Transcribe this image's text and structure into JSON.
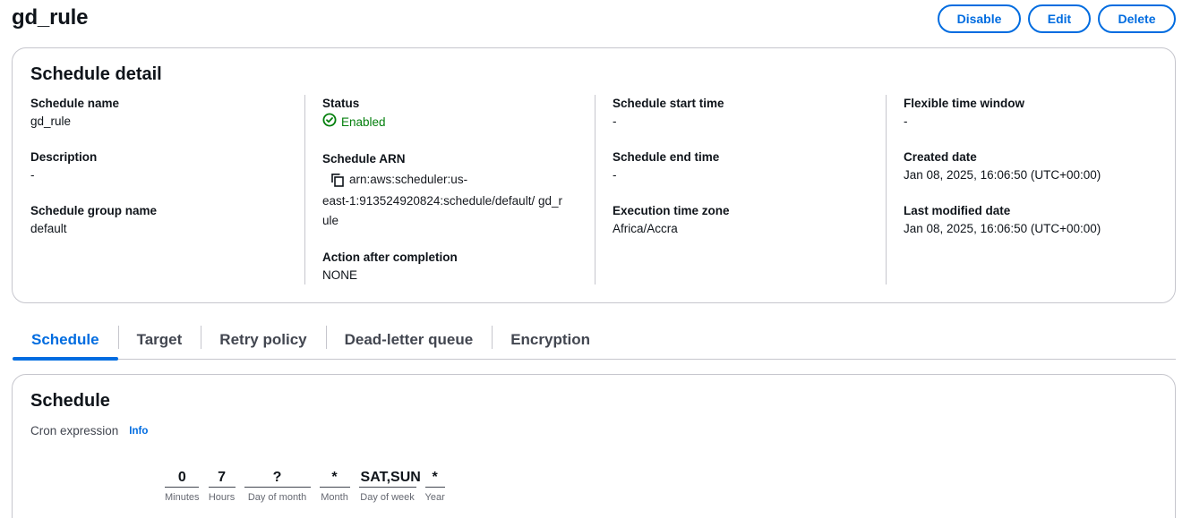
{
  "page": {
    "title": "gd_rule"
  },
  "actions": {
    "disable": "Disable",
    "edit": "Edit",
    "delete": "Delete"
  },
  "detail": {
    "title": "Schedule detail",
    "schedule_name": {
      "label": "Schedule name",
      "value": "gd_rule"
    },
    "description": {
      "label": "Description",
      "value": "-"
    },
    "group_name": {
      "label": "Schedule group name",
      "value": "default"
    },
    "status": {
      "label": "Status",
      "value": "Enabled",
      "icon": "check-circle-icon",
      "color": "#037f0c"
    },
    "arn": {
      "label": "Schedule ARN",
      "line1": "arn:aws:scheduler:us-",
      "rest": "east-1:913524920824:schedule/default/ gd_rule",
      "icon": "copy-icon"
    },
    "action_after": {
      "label": "Action after completion",
      "value": "NONE"
    },
    "start_time": {
      "label": "Schedule start time",
      "value": "-"
    },
    "end_time": {
      "label": "Schedule end time",
      "value": "-"
    },
    "timezone": {
      "label": "Execution time zone",
      "value": "Africa/Accra"
    },
    "flex_window": {
      "label": "Flexible time window",
      "value": "-"
    },
    "created": {
      "label": "Created date",
      "value": "Jan 08, 2025, 16:06:50 (UTC+00:00)"
    },
    "modified": {
      "label": "Last modified date",
      "value": "Jan 08, 2025, 16:06:50 (UTC+00:00)"
    }
  },
  "tabs": [
    {
      "label": "Schedule",
      "active": true
    },
    {
      "label": "Target"
    },
    {
      "label": "Retry policy"
    },
    {
      "label": "Dead-letter queue"
    },
    {
      "label": "Encryption"
    }
  ],
  "schedule": {
    "title": "Schedule",
    "cron_label": "Cron expression",
    "info": "Info",
    "fields": [
      {
        "value": "0",
        "label": "Minutes"
      },
      {
        "value": "7",
        "label": "Hours"
      },
      {
        "value": "?",
        "label": "Day of month"
      },
      {
        "value": "*",
        "label": "Month"
      },
      {
        "value": "SAT,SUN",
        "label": "Day of week"
      },
      {
        "value": "*",
        "label": "Year"
      }
    ]
  },
  "colors": {
    "accent": "#006ce0",
    "success": "#037f0c",
    "border": "#c6c6cd"
  }
}
